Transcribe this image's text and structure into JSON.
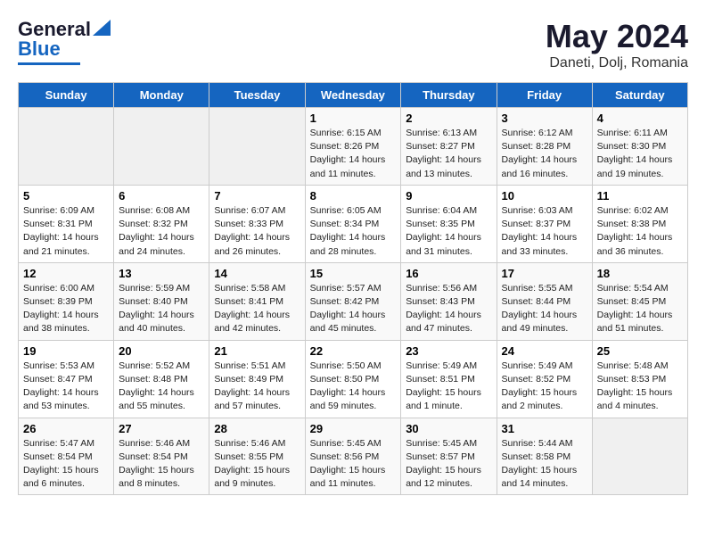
{
  "header": {
    "logo_general": "General",
    "logo_blue": "Blue",
    "title": "May 2024",
    "subtitle": "Daneti, Dolj, Romania"
  },
  "columns": [
    "Sunday",
    "Monday",
    "Tuesday",
    "Wednesday",
    "Thursday",
    "Friday",
    "Saturday"
  ],
  "weeks": [
    [
      {
        "day": "",
        "info": ""
      },
      {
        "day": "",
        "info": ""
      },
      {
        "day": "",
        "info": ""
      },
      {
        "day": "1",
        "info": "Sunrise: 6:15 AM\nSunset: 8:26 PM\nDaylight: 14 hours\nand 11 minutes."
      },
      {
        "day": "2",
        "info": "Sunrise: 6:13 AM\nSunset: 8:27 PM\nDaylight: 14 hours\nand 13 minutes."
      },
      {
        "day": "3",
        "info": "Sunrise: 6:12 AM\nSunset: 8:28 PM\nDaylight: 14 hours\nand 16 minutes."
      },
      {
        "day": "4",
        "info": "Sunrise: 6:11 AM\nSunset: 8:30 PM\nDaylight: 14 hours\nand 19 minutes."
      }
    ],
    [
      {
        "day": "5",
        "info": "Sunrise: 6:09 AM\nSunset: 8:31 PM\nDaylight: 14 hours\nand 21 minutes."
      },
      {
        "day": "6",
        "info": "Sunrise: 6:08 AM\nSunset: 8:32 PM\nDaylight: 14 hours\nand 24 minutes."
      },
      {
        "day": "7",
        "info": "Sunrise: 6:07 AM\nSunset: 8:33 PM\nDaylight: 14 hours\nand 26 minutes."
      },
      {
        "day": "8",
        "info": "Sunrise: 6:05 AM\nSunset: 8:34 PM\nDaylight: 14 hours\nand 28 minutes."
      },
      {
        "day": "9",
        "info": "Sunrise: 6:04 AM\nSunset: 8:35 PM\nDaylight: 14 hours\nand 31 minutes."
      },
      {
        "day": "10",
        "info": "Sunrise: 6:03 AM\nSunset: 8:37 PM\nDaylight: 14 hours\nand 33 minutes."
      },
      {
        "day": "11",
        "info": "Sunrise: 6:02 AM\nSunset: 8:38 PM\nDaylight: 14 hours\nand 36 minutes."
      }
    ],
    [
      {
        "day": "12",
        "info": "Sunrise: 6:00 AM\nSunset: 8:39 PM\nDaylight: 14 hours\nand 38 minutes."
      },
      {
        "day": "13",
        "info": "Sunrise: 5:59 AM\nSunset: 8:40 PM\nDaylight: 14 hours\nand 40 minutes."
      },
      {
        "day": "14",
        "info": "Sunrise: 5:58 AM\nSunset: 8:41 PM\nDaylight: 14 hours\nand 42 minutes."
      },
      {
        "day": "15",
        "info": "Sunrise: 5:57 AM\nSunset: 8:42 PM\nDaylight: 14 hours\nand 45 minutes."
      },
      {
        "day": "16",
        "info": "Sunrise: 5:56 AM\nSunset: 8:43 PM\nDaylight: 14 hours\nand 47 minutes."
      },
      {
        "day": "17",
        "info": "Sunrise: 5:55 AM\nSunset: 8:44 PM\nDaylight: 14 hours\nand 49 minutes."
      },
      {
        "day": "18",
        "info": "Sunrise: 5:54 AM\nSunset: 8:45 PM\nDaylight: 14 hours\nand 51 minutes."
      }
    ],
    [
      {
        "day": "19",
        "info": "Sunrise: 5:53 AM\nSunset: 8:47 PM\nDaylight: 14 hours\nand 53 minutes."
      },
      {
        "day": "20",
        "info": "Sunrise: 5:52 AM\nSunset: 8:48 PM\nDaylight: 14 hours\nand 55 minutes."
      },
      {
        "day": "21",
        "info": "Sunrise: 5:51 AM\nSunset: 8:49 PM\nDaylight: 14 hours\nand 57 minutes."
      },
      {
        "day": "22",
        "info": "Sunrise: 5:50 AM\nSunset: 8:50 PM\nDaylight: 14 hours\nand 59 minutes."
      },
      {
        "day": "23",
        "info": "Sunrise: 5:49 AM\nSunset: 8:51 PM\nDaylight: 15 hours\nand 1 minute."
      },
      {
        "day": "24",
        "info": "Sunrise: 5:49 AM\nSunset: 8:52 PM\nDaylight: 15 hours\nand 2 minutes."
      },
      {
        "day": "25",
        "info": "Sunrise: 5:48 AM\nSunset: 8:53 PM\nDaylight: 15 hours\nand 4 minutes."
      }
    ],
    [
      {
        "day": "26",
        "info": "Sunrise: 5:47 AM\nSunset: 8:54 PM\nDaylight: 15 hours\nand 6 minutes."
      },
      {
        "day": "27",
        "info": "Sunrise: 5:46 AM\nSunset: 8:54 PM\nDaylight: 15 hours\nand 8 minutes."
      },
      {
        "day": "28",
        "info": "Sunrise: 5:46 AM\nSunset: 8:55 PM\nDaylight: 15 hours\nand 9 minutes."
      },
      {
        "day": "29",
        "info": "Sunrise: 5:45 AM\nSunset: 8:56 PM\nDaylight: 15 hours\nand 11 minutes."
      },
      {
        "day": "30",
        "info": "Sunrise: 5:45 AM\nSunset: 8:57 PM\nDaylight: 15 hours\nand 12 minutes."
      },
      {
        "day": "31",
        "info": "Sunrise: 5:44 AM\nSunset: 8:58 PM\nDaylight: 15 hours\nand 14 minutes."
      },
      {
        "day": "",
        "info": ""
      }
    ]
  ]
}
